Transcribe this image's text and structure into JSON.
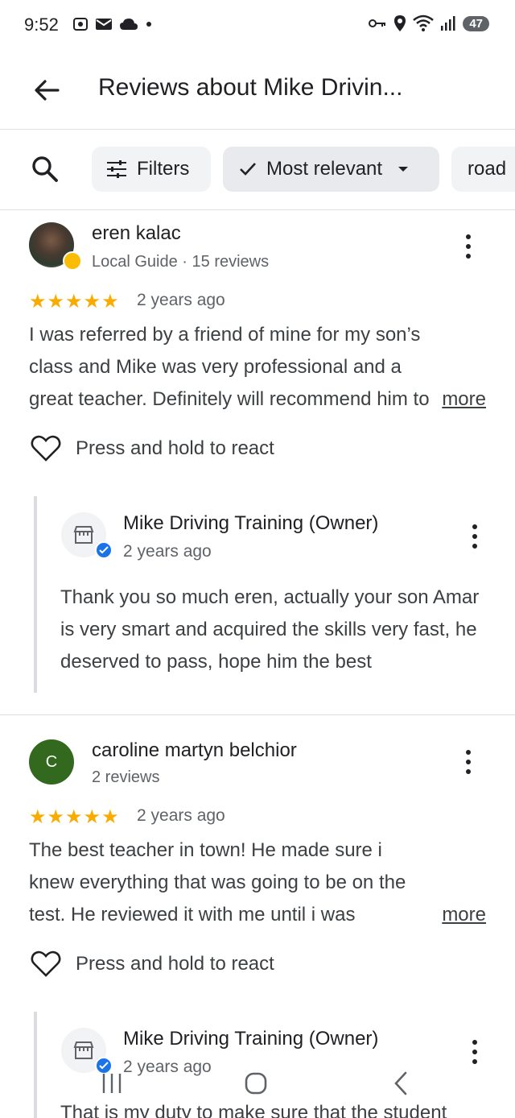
{
  "status_bar": {
    "time": "9:52",
    "battery": "47",
    "left_icons": [
      "screenshot-icon",
      "mail-icon",
      "cloud-icon",
      "dot-icon"
    ],
    "right_icons": [
      "key-icon",
      "location-icon",
      "wifi-icon",
      "signal-icon",
      "battery-icon"
    ]
  },
  "header": {
    "title": "Reviews about Mike Drivin..."
  },
  "filters": {
    "filters_label": "Filters",
    "sort_label": "Most relevant",
    "topic_label": "road"
  },
  "reviews": [
    {
      "name": "eren kalac",
      "meta": "Local Guide · 15 reviews",
      "stars": "★★★★★",
      "rating": 5,
      "date": "2 years ago",
      "text": "I was referred by a friend of mine for my son’s class and Mike was very professional and a great teacher. Definitely will recommend him to ...",
      "more": "more",
      "react": "Press and hold to react",
      "owner": {
        "name": "Mike Driving Training (Owner)",
        "date": "2 years ago",
        "text": "Thank you so much eren, actually your son Amar is very smart and acquired the skills very fast, he deserved to pass, hope him the best"
      }
    },
    {
      "name": "caroline martyn belchior",
      "avatar_letter": "C",
      "meta": "2 reviews",
      "stars": "★★★★★",
      "rating": 5,
      "date": "2 years ago",
      "text": "The best teacher in town! He made sure i knew everything that was going to be on the test. He reviewed it with me until i was confident in...",
      "more": "more",
      "react": "Press and hold to react",
      "owner": {
        "name": "Mike Driving Training (Owner)",
        "date": "2 years ago",
        "text": "That is my duty to make sure that the student"
      }
    }
  ],
  "colors": {
    "star": "#f9ab00",
    "verified": "#1a73e8",
    "avatar_green": "#33691e"
  }
}
